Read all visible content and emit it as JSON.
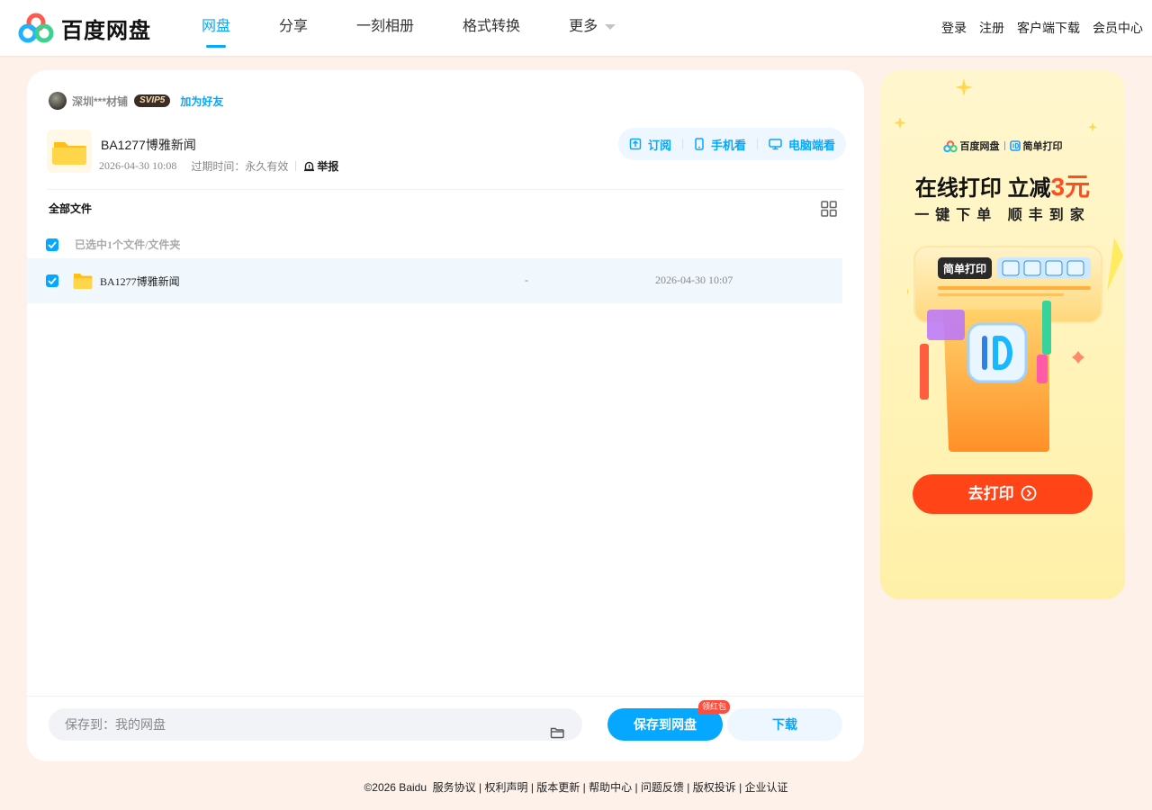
{
  "header": {
    "logo_text": "百度网盘",
    "nav": [
      {
        "label": "网盘",
        "active": true
      },
      {
        "label": "分享",
        "active": false
      },
      {
        "label": "一刻相册",
        "active": false
      },
      {
        "label": "格式转换",
        "active": false
      },
      {
        "label": "更多",
        "active": false
      }
    ],
    "right_links": [
      "登录",
      "注册",
      "客户端下载",
      "会员中心"
    ]
  },
  "share": {
    "sharer_name": "深圳***材铺",
    "badge": "SVIP5",
    "add_friend": "加为好友",
    "title": "BA1277博雅新闻",
    "created": "2026-04-30 10:08",
    "expire_label": "过期时间：永久有效",
    "report": "举报",
    "actions": {
      "subscribe": "订阅",
      "mobile": "手机看",
      "desktop": "电脑端看"
    }
  },
  "list": {
    "all_files": "全部文件",
    "selected_text": "已选中1个文件/文件夹",
    "rows": [
      {
        "name": "BA1277博雅新闻",
        "size": "-",
        "date": "2026-04-30 10:07",
        "checked": true
      }
    ]
  },
  "bottom": {
    "save_path": "保存到：我的网盘",
    "save_button": "保存到网盘",
    "redpack": "领红包",
    "download_button": "下载"
  },
  "ad": {
    "brand_left": "百度网盘",
    "brand_right": "简单打印",
    "title_prefix": "在线打印 立减",
    "title_highlight": "3元",
    "subtitle": "一键下单 顺丰到家",
    "printer_label": "简单打印",
    "button": "去打印"
  },
  "footer": {
    "copyright": "©2026 Baidu",
    "links": [
      "服务协议",
      "权利声明",
      "版本更新",
      "帮助中心",
      "问题反馈",
      "版权投诉",
      "企业认证"
    ]
  },
  "colors": {
    "accent": "#06a7ff",
    "ad_button": "#ff4418",
    "page_bg": "#fdf1ea"
  }
}
